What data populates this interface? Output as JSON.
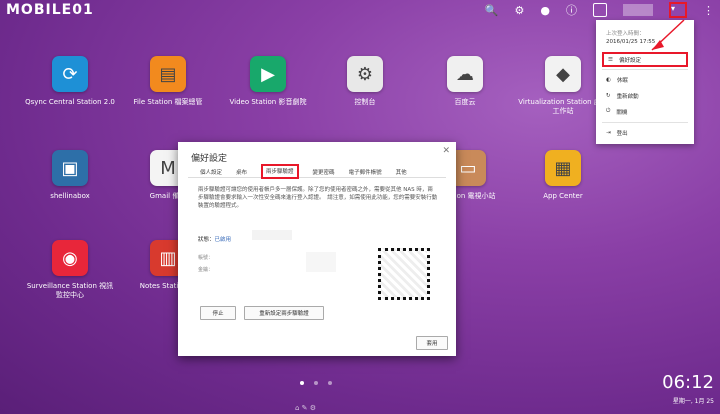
{
  "watermark": "MOBILE01",
  "topbar": {
    "icons": [
      "search-icon",
      "tasks-icon",
      "notify-icon",
      "info-icon",
      "user-icon",
      "menu-caret-icon",
      "more-icon"
    ],
    "notify_badge": "1"
  },
  "apps": [
    {
      "label": "Qsync Central Station 2.0",
      "icon": "sync-icon",
      "color": "#1e90d6"
    },
    {
      "label": "File Station 檔案總管",
      "icon": "folder-icon",
      "color": "#f28a1e"
    },
    {
      "label": "Video Station 影音劇院",
      "icon": "film-icon",
      "color": "#18a86b"
    },
    {
      "label": "控制台",
      "icon": "gear-icon",
      "color": "#e8e8e8"
    },
    {
      "label": "百度云",
      "icon": "cloud-icon",
      "color": "#f0f0f0"
    },
    {
      "label": "Virtualization Station 虛擬工作站",
      "icon": "cube-icon",
      "color": "#f2f2f2"
    },
    {
      "label": "shellinabox",
      "icon": "shell-icon",
      "color": "#2d6fa8"
    },
    {
      "label": "Gmail 備份",
      "icon": "mail-icon",
      "color": "#f4f4f4"
    },
    {
      "label": "Station 電視小站",
      "icon": "tv-icon",
      "color": "#c98a5a"
    },
    {
      "label": "App Center",
      "icon": "appcenter-icon",
      "color": "#f0b020"
    },
    {
      "label": "Surveillance Station 視訊監控中心",
      "icon": "camera-icon",
      "color": "#e8263a"
    },
    {
      "label": "Notes Station 筆",
      "icon": "notes-icon",
      "color": "#d83a2e"
    }
  ],
  "dialog": {
    "title": "偏好設定",
    "tabs": [
      "個人設定",
      "桌布",
      "兩步驟驗證",
      "變更密碼",
      "電子郵件帳號",
      "其他"
    ],
    "active_tab": 2,
    "description": "兩步驟驗證可讓您的使用者帳戶多一層保護。除了您的使用者密碼之外，需要從其他 NAS 時，兩步驟驗證會要求輸入一次性安全碼來進行登入認證。　請注意，如需使用此功能，您的需要安裝行動裝置的驗證程式。",
    "status_label": "狀態：",
    "status_value": "已啟用",
    "field1": "帳號：",
    "field2": "金鑰：",
    "stop_button": "停止",
    "reset_button": "重新設定兩步驟驗證",
    "apply_button": "套用"
  },
  "dropdown": {
    "last_login_label": "上次登入時間：",
    "last_login_time": "2016/01/25 17:55",
    "items": [
      {
        "label": "偏好設定",
        "icon": "list-icon"
      },
      {
        "label": "休眠",
        "icon": "sleep-icon"
      },
      {
        "label": "重新啟動",
        "icon": "restart-icon"
      },
      {
        "label": "關機",
        "icon": "power-icon"
      },
      {
        "label": "登出",
        "icon": "logout-icon"
      }
    ]
  },
  "clock": "06:12",
  "date": "星期一, 1月 25"
}
